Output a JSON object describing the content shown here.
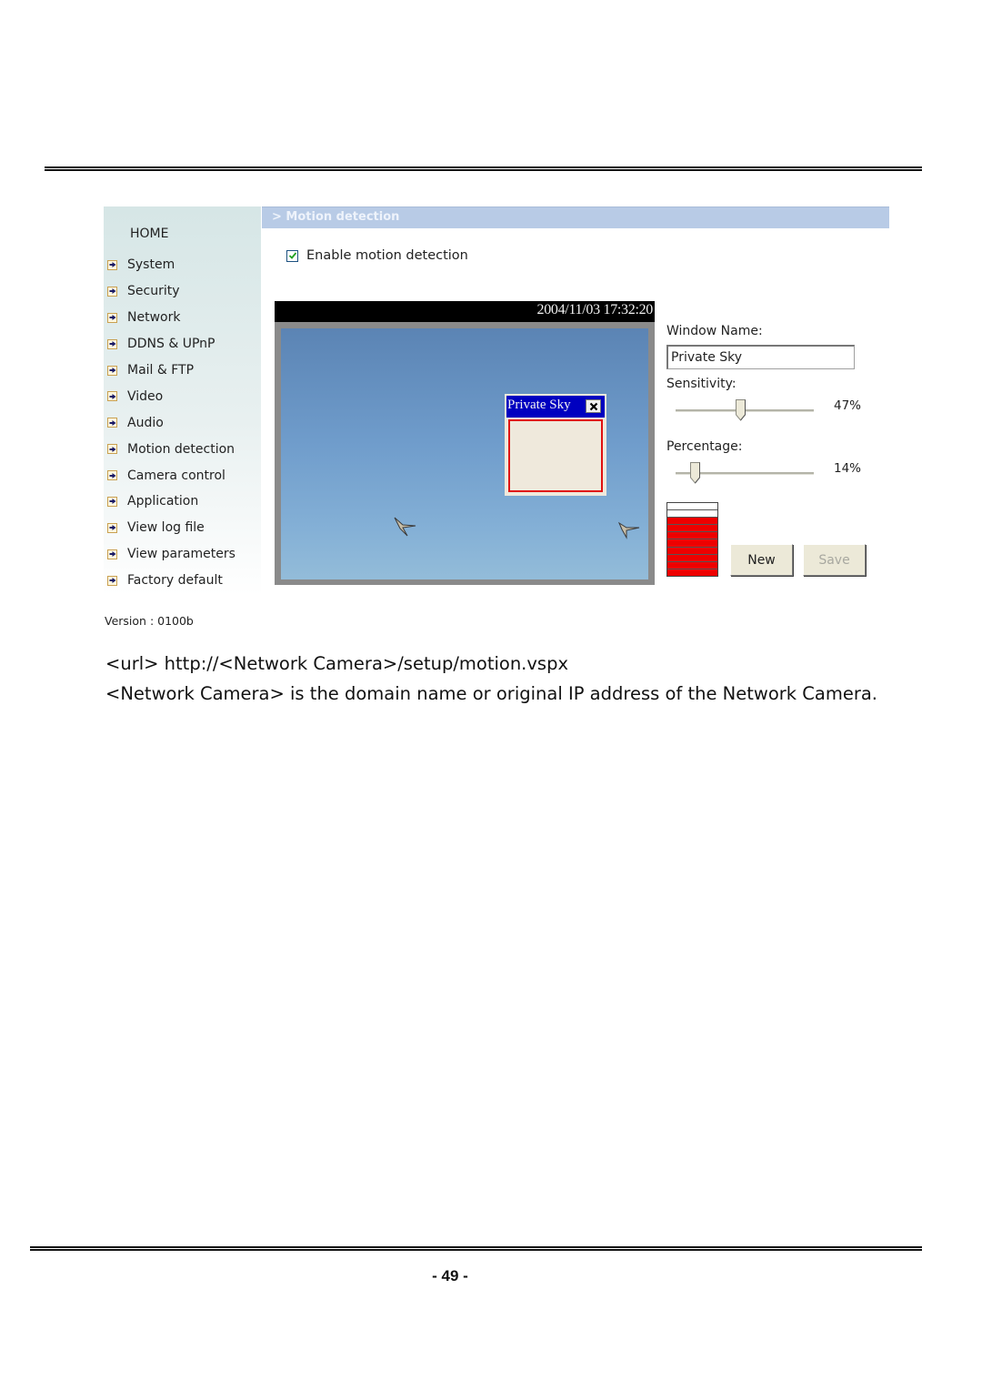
{
  "page": {
    "page_number": "- 49 -"
  },
  "sidebar": {
    "home_label": "HOME",
    "items": [
      {
        "label": "System"
      },
      {
        "label": "Security"
      },
      {
        "label": "Network"
      },
      {
        "label": "DDNS & UPnP"
      },
      {
        "label": "Mail & FTP"
      },
      {
        "label": "Video"
      },
      {
        "label": "Audio"
      },
      {
        "label": "Motion detection"
      },
      {
        "label": "Camera control"
      },
      {
        "label": "Application"
      },
      {
        "label": "View log file"
      },
      {
        "label": "View parameters"
      },
      {
        "label": "Factory default"
      }
    ],
    "item_icon": "arrow-right-icon",
    "version": "Version : 0100b"
  },
  "main": {
    "title": "> Motion detection",
    "enable_label": "Enable motion detection",
    "enable_checked": true,
    "video": {
      "timestamp": "2004/11/03 17:32:20",
      "motion_window": {
        "title": "Private Sky",
        "close_icon": "close-icon"
      }
    },
    "controls": {
      "window_name_label": "Window Name:",
      "window_name_value": "Private Sky",
      "sensitivity_label": "Sensitivity:",
      "sensitivity_value": 47,
      "sensitivity_text": "47%",
      "percentage_label": "Percentage:",
      "percentage_value": 14,
      "percentage_text": "14%",
      "activity_meter": {
        "segments": 10,
        "filled_segments": 8,
        "fill_color": "#ee0000",
        "empty_color": "#ffffff"
      },
      "new_button": "New",
      "save_button": "Save",
      "save_disabled": true
    }
  },
  "document": {
    "url_line": "<url> http://<Network Camera>/setup/motion.vspx",
    "note_line": "<Network Camera> is the domain name or original IP address of the Network Camera."
  },
  "colors": {
    "title_bar": "#b8cbe6",
    "motion_window_title": "#0000c0",
    "motion_window_border": "#e01010"
  }
}
